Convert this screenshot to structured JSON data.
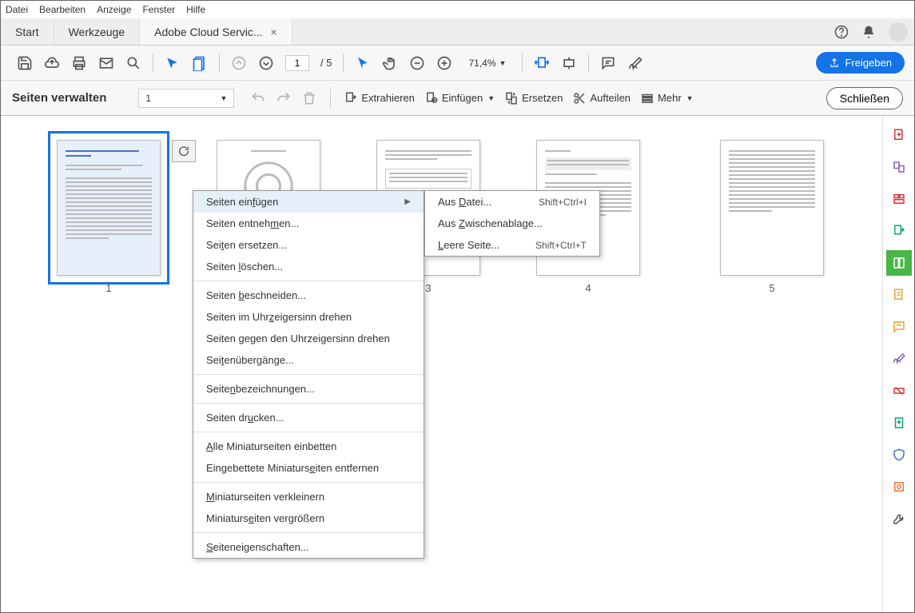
{
  "menubar": [
    "Datei",
    "Bearbeiten",
    "Anzeige",
    "Fenster",
    "Hilfe"
  ],
  "tabs": {
    "start": "Start",
    "tools": "Werkzeuge",
    "doc": "Adobe Cloud Servic..."
  },
  "toolbar": {
    "page_current": "1",
    "page_total": "5",
    "zoom": "71,4%",
    "share": "Freigeben"
  },
  "subbar": {
    "title": "Seiten verwalten",
    "page_sel": "1",
    "extract": "Extrahieren",
    "insert": "Einfügen",
    "replace": "Ersetzen",
    "split": "Aufteilen",
    "more": "Mehr",
    "close": "Schließen"
  },
  "thumbs": [
    "1",
    "",
    "3",
    "4",
    "5"
  ],
  "ctx_main": [
    "Seiten einfügen",
    "Seiten entnehmen...",
    "Seiten ersetzen...",
    "Seiten löschen...",
    "---",
    "Seiten beschneiden...",
    "Seiten im Uhrzeigersinn drehen",
    "Seiten gegen den Uhrzeigersinn drehen",
    "Seitenübergänge...",
    "---",
    "Seitenbezeichnungen...",
    "---",
    "Seiten drucken...",
    "---",
    "Alle Miniaturseiten einbetten",
    "Eingebettete Miniaturseiten entfernen",
    "---",
    "Miniaturseiten verkleinern",
    "Miniaturseiten vergrößern",
    "---",
    "Seiteneigenschaften..."
  ],
  "ctx_sub": [
    {
      "label": "Aus Datei...",
      "short": "Shift+Ctrl+I"
    },
    {
      "label": "Aus Zwischenablage...",
      "short": ""
    },
    {
      "label": "Leere Seite...",
      "short": "Shift+Ctrl+T"
    }
  ]
}
